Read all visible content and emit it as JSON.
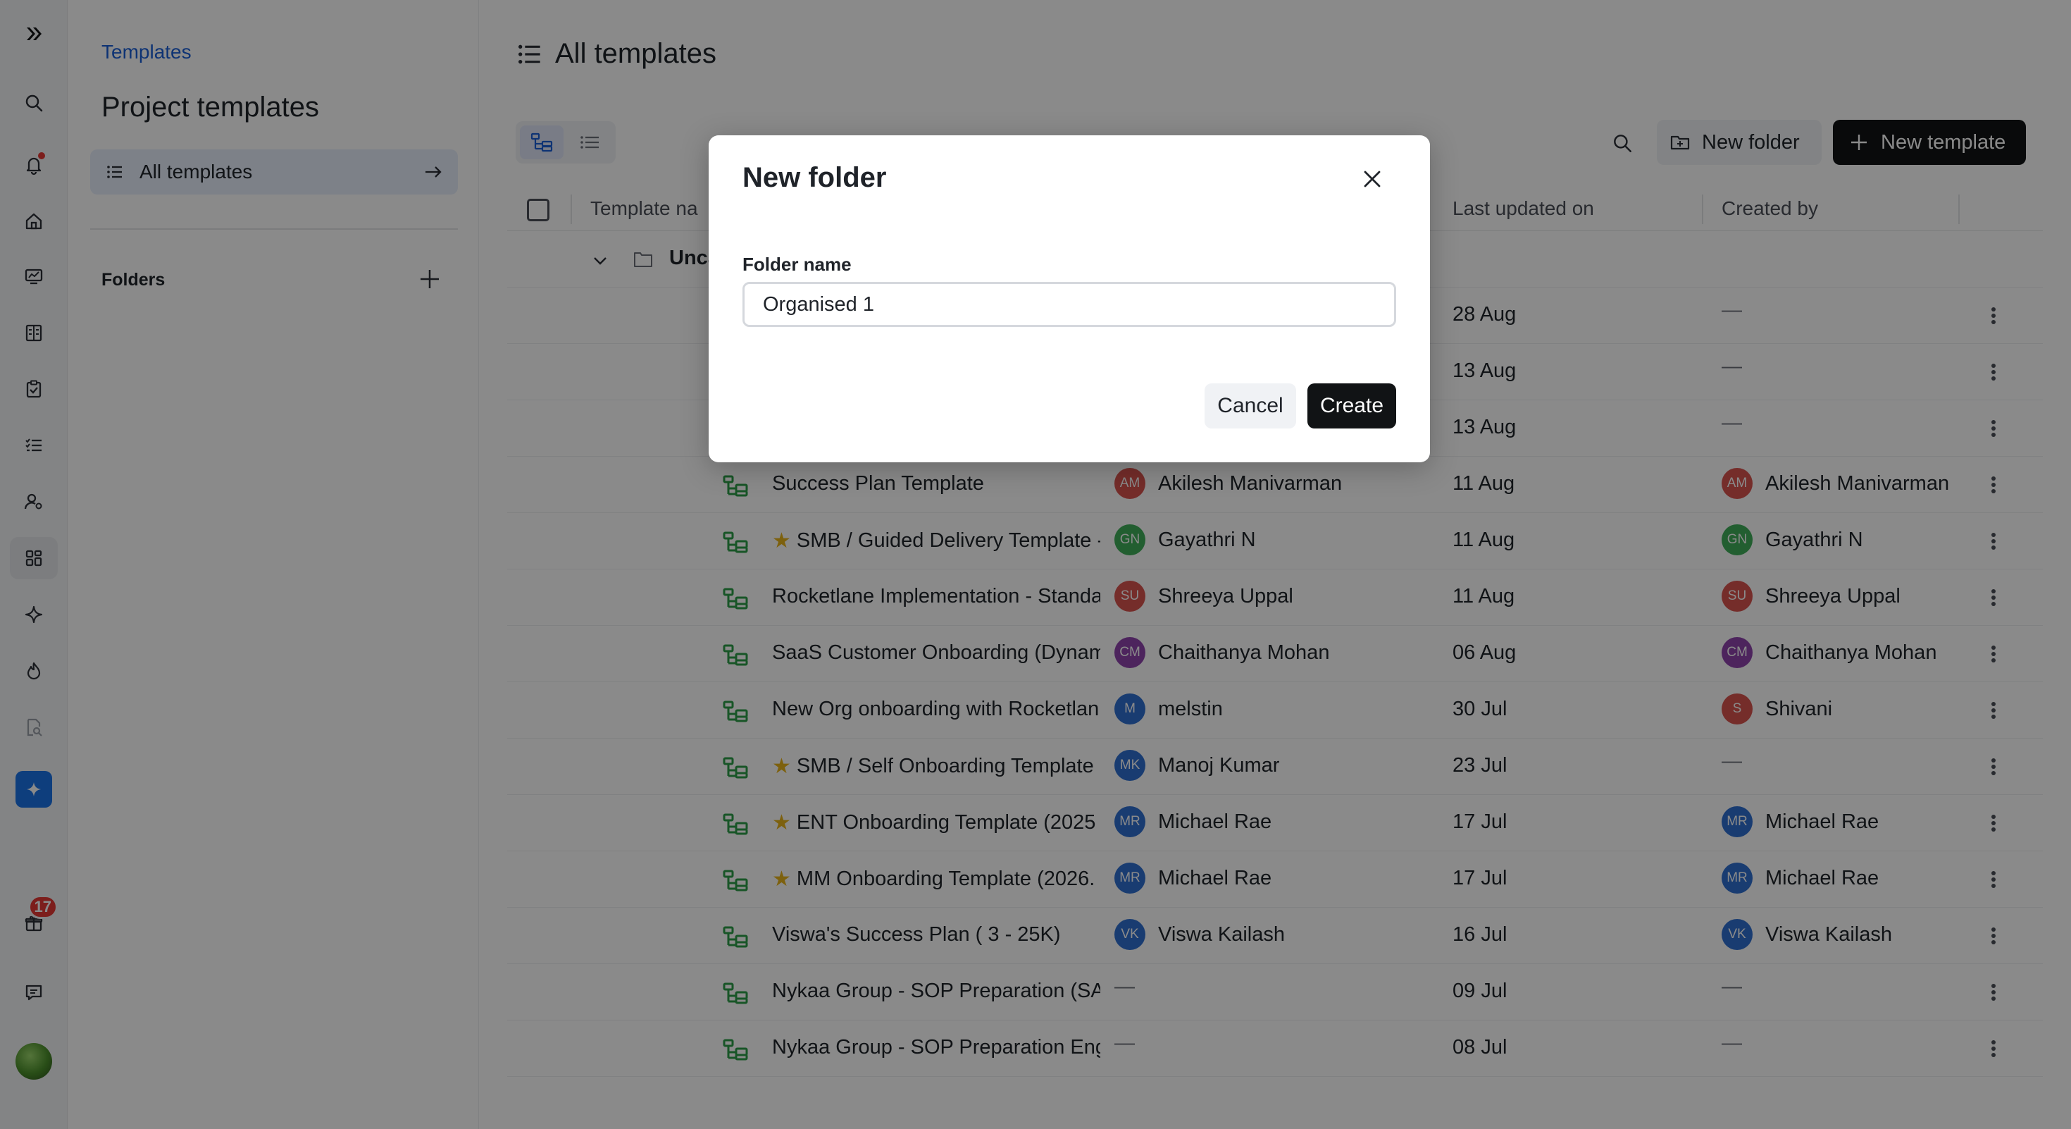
{
  "rail": {
    "items": [
      {
        "icon": "logo-icon"
      },
      {
        "icon": "search-icon"
      },
      {
        "icon": "bell-icon"
      },
      {
        "icon": "home-icon"
      },
      {
        "icon": "monitor-chart-icon"
      },
      {
        "icon": "building-icon"
      },
      {
        "icon": "clipboard-check-icon"
      },
      {
        "icon": "checklist-icon"
      },
      {
        "icon": "user-settings-icon"
      },
      {
        "icon": "grid-icon"
      },
      {
        "icon": "sparkle-icon"
      },
      {
        "icon": "flame-icon"
      },
      {
        "icon": "file-search-icon"
      },
      {
        "icon": "ai-sparkle-icon"
      },
      {
        "icon": "gift-icon"
      },
      {
        "icon": "chat-icon"
      }
    ],
    "gift_badge": "17"
  },
  "sidebar": {
    "breadcrumb": "Templates",
    "title": "Project templates",
    "all_templates": "All templates",
    "folders_label": "Folders"
  },
  "main": {
    "title": "All templates",
    "new_folder": "New folder",
    "new_template": "New template",
    "columns": {
      "template_name": "Template na",
      "last_updated": "Last updated on",
      "created_by": "Created by"
    },
    "group_label": "Unca",
    "rows": [
      {
        "name": "",
        "starred": false,
        "owner": "",
        "owner_initials": "",
        "owner_color": "",
        "date": "28 Aug",
        "creator": "—",
        "creator_initials": "",
        "creator_color": ""
      },
      {
        "name": "",
        "starred": false,
        "owner": "",
        "owner_initials": "",
        "owner_color": "",
        "date": "13 Aug",
        "creator": "—",
        "creator_initials": "",
        "creator_color": ""
      },
      {
        "name": "",
        "starred": false,
        "owner": "",
        "owner_initials": "",
        "owner_color": "",
        "date": "13 Aug",
        "creator": "—",
        "creator_initials": "",
        "creator_color": ""
      },
      {
        "name": "Success Plan Template",
        "starred": false,
        "owner": "Akilesh Manivarman",
        "owner_initials": "AM",
        "owner_color": "red",
        "date": "11 Aug",
        "creator": "Akilesh Manivarman",
        "creator_initials": "AM",
        "creator_color": "red"
      },
      {
        "name": "SMB / Guided Delivery Template -",
        "starred": true,
        "owner": "Gayathri N",
        "owner_initials": "GN",
        "owner_color": "green",
        "date": "11 Aug",
        "creator": "Gayathri N",
        "creator_initials": "GN",
        "creator_color": "green"
      },
      {
        "name": "Rocketlane Implementation - Standa",
        "starred": false,
        "owner": "Shreeya Uppal",
        "owner_initials": "SU",
        "owner_color": "red",
        "date": "11 Aug",
        "creator": "Shreeya Uppal",
        "creator_initials": "SU",
        "creator_color": "red"
      },
      {
        "name": "SaaS Customer Onboarding (Dynam",
        "starred": false,
        "owner": "Chaithanya Mohan",
        "owner_initials": "CM",
        "owner_color": "purple",
        "date": "06 Aug",
        "creator": "Chaithanya Mohan",
        "creator_initials": "CM",
        "creator_color": "purple"
      },
      {
        "name": "New Org onboarding with Rocketlan",
        "starred": false,
        "owner": "melstin",
        "owner_initials": "M",
        "owner_color": "blue",
        "date": "30 Jul",
        "creator": "Shivani",
        "creator_initials": "S",
        "creator_color": "red"
      },
      {
        "name": "SMB / Self Onboarding Template",
        "starred": true,
        "owner": "Manoj Kumar",
        "owner_initials": "MK",
        "owner_color": "blue",
        "date": "23 Jul",
        "creator": "—",
        "creator_initials": "",
        "creator_color": ""
      },
      {
        "name": "ENT Onboarding Template (2025",
        "starred": true,
        "owner": "Michael Rae",
        "owner_initials": "MR",
        "owner_color": "blue",
        "date": "17 Jul",
        "creator": "Michael Rae",
        "creator_initials": "MR",
        "creator_color": "blue"
      },
      {
        "name": "MM Onboarding Template (2026.",
        "starred": true,
        "owner": "Michael Rae",
        "owner_initials": "MR",
        "owner_color": "blue",
        "date": "17 Jul",
        "creator": "Michael Rae",
        "creator_initials": "MR",
        "creator_color": "blue"
      },
      {
        "name": "Viswa's Success Plan ( 3 - 25K)",
        "starred": false,
        "owner": "Viswa Kailash",
        "owner_initials": "VK",
        "owner_color": "blue",
        "date": "16 Jul",
        "creator": "Viswa Kailash",
        "creator_initials": "VK",
        "creator_color": "blue"
      },
      {
        "name": "Nykaa Group - SOP Preparation (SA",
        "starred": false,
        "owner": "—",
        "owner_initials": "",
        "owner_color": "",
        "date": "09 Jul",
        "creator": "—",
        "creator_initials": "",
        "creator_color": ""
      },
      {
        "name": "Nykaa Group - SOP Preparation Eng",
        "starred": false,
        "owner": "—",
        "owner_initials": "",
        "owner_color": "",
        "date": "08 Jul",
        "creator": "—",
        "creator_initials": "",
        "creator_color": ""
      }
    ]
  },
  "modal": {
    "title": "New folder",
    "field_label": "Folder name",
    "field_value": "Organised 1",
    "cancel": "Cancel",
    "create": "Create"
  },
  "colors": {
    "accent_blue": "#1a5fd6",
    "primary_dark": "#111315",
    "template_icon_green": "#2e9e49"
  }
}
